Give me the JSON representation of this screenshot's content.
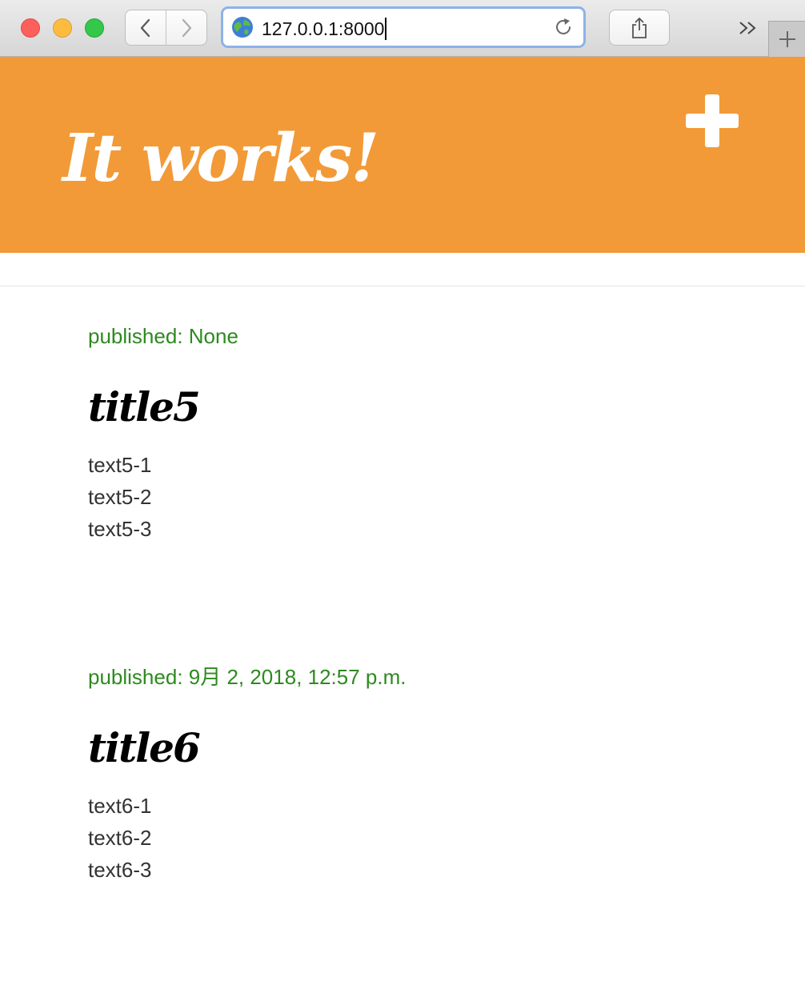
{
  "browser": {
    "url": "127.0.0.1:8000"
  },
  "header": {
    "title": "It works!",
    "add_icon": "plus-icon"
  },
  "posts": [
    {
      "published": "published: None",
      "title": "title5",
      "lines": [
        "text5-1",
        "text5-2",
        "text5-3"
      ]
    },
    {
      "published": "published: 9月 2, 2018, 12:57 p.m.",
      "title": "title6",
      "lines": [
        "text6-1",
        "text6-2",
        "text6-3"
      ]
    }
  ],
  "colors": {
    "header_bg": "#f29a37",
    "date_text": "#2d8a1f"
  }
}
